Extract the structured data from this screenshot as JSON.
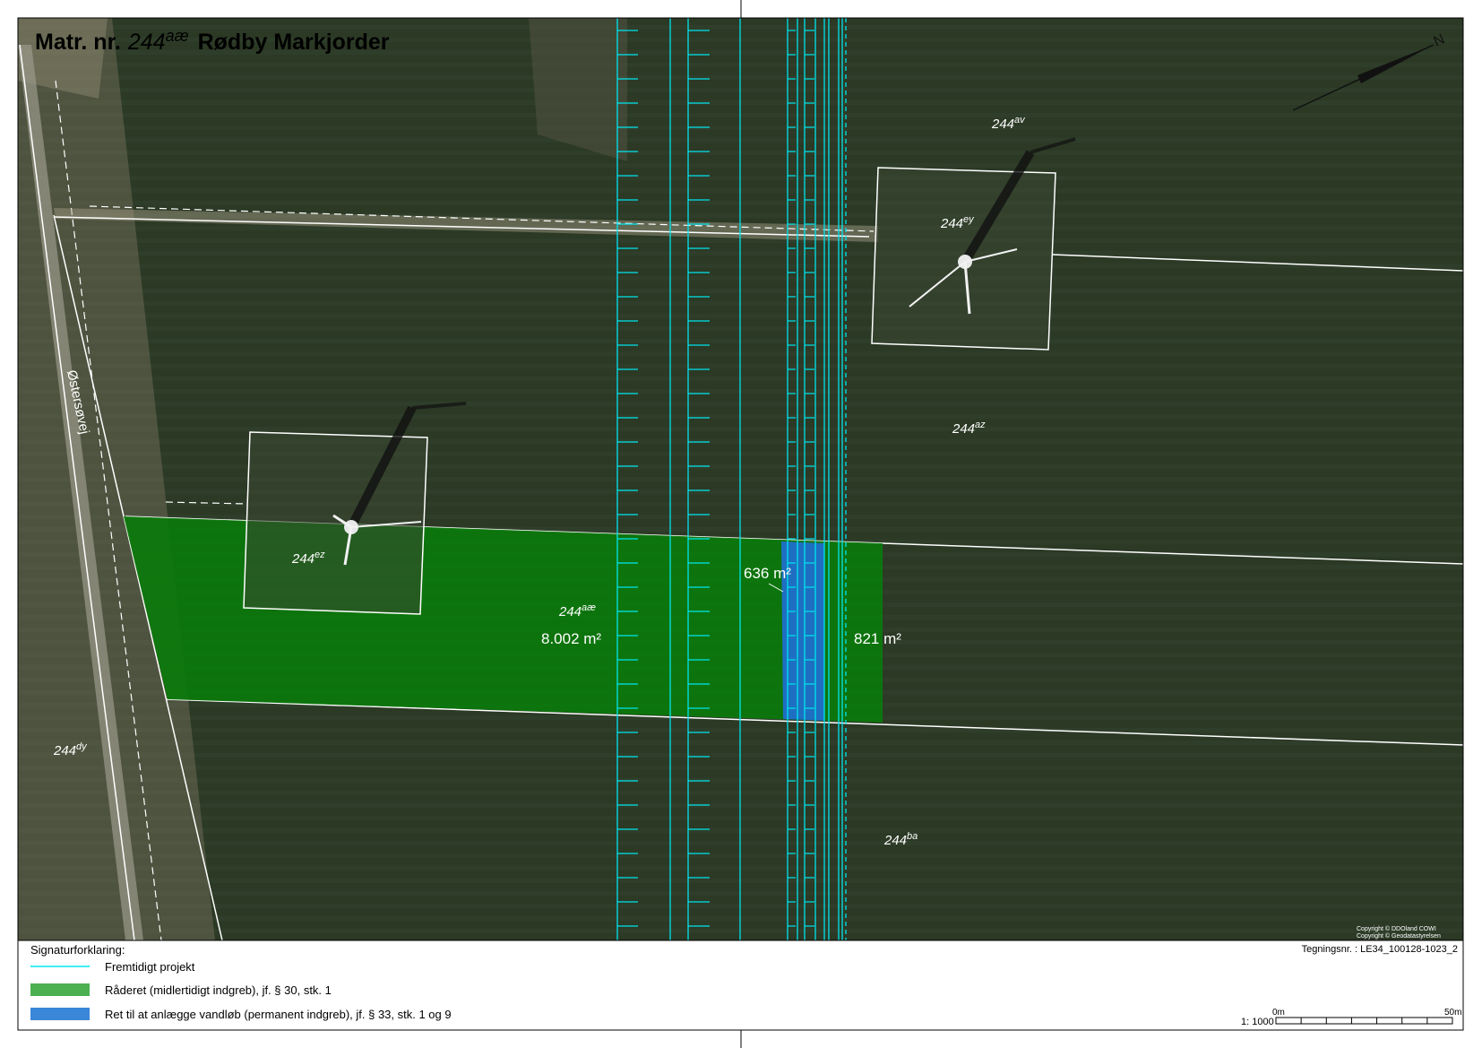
{
  "title": {
    "prefix": "Matr. nr.",
    "parcel_number": "244",
    "parcel_suffix": "aæ",
    "place": "Rødby Markjorder"
  },
  "road_name": "Østersøvej",
  "parcels": [
    {
      "id": "av",
      "number": "244",
      "suffix": "av"
    },
    {
      "id": "ey",
      "number": "244",
      "suffix": "ey"
    },
    {
      "id": "az",
      "number": "244",
      "suffix": "az"
    },
    {
      "id": "ez",
      "number": "244",
      "suffix": "ez"
    },
    {
      "id": "ae",
      "number": "244",
      "suffix": "aæ"
    },
    {
      "id": "dy",
      "number": "244",
      "suffix": "dy"
    },
    {
      "id": "ba",
      "number": "244",
      "suffix": "ba"
    }
  ],
  "areas": {
    "temporary_west": "8.002 m²",
    "permanent": "636 m²",
    "temporary_east": "821 m²"
  },
  "copyright": {
    "line1": "Copyright © DDOland COWI",
    "line2": "Copyright © Geodatastyrelsen"
  },
  "legend": {
    "heading": "Signaturforklaring:",
    "items": [
      {
        "label": "Fremtidigt projekt",
        "symbol": "line",
        "color": "#00e5ee"
      },
      {
        "label": "Råderet (midlertidigt indgreb), jf. § 30, stk. 1",
        "symbol": "fill",
        "color": "#4caf50"
      },
      {
        "label": "Ret til at anlægge vandløb (permanent indgreb), jf. § 33, stk. 1 og 9",
        "symbol": "fill",
        "color": "#3a86d8"
      }
    ]
  },
  "drawing_number": "Tegningsnr. : LE34_100128-1023_2",
  "scale": {
    "ratio": "1: 1000",
    "start_label": "0m",
    "end_label": "50m"
  },
  "north_arrow_label": "N",
  "colors": {
    "field": "#2c3a26",
    "temporary_fill": "#0b7a0b",
    "permanent_fill": "#1f6fd0",
    "project_line": "#00e5ee",
    "boundary": "#ffffff"
  }
}
